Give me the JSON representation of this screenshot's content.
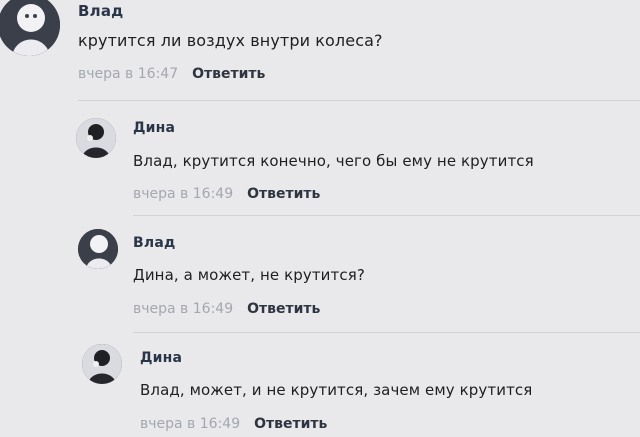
{
  "comments": [
    {
      "author": "Влад",
      "text": "крутится ли воздух внутри колеса?",
      "time": "вчера в 16:47",
      "reply": "Ответить",
      "avatar": "avatar-white-figure"
    },
    {
      "author": "Дина",
      "text": "Влад, крутится конечно, чего бы ему не крутится",
      "time": "вчера в 16:49",
      "reply": "Ответить",
      "avatar": "avatar-dark-figure"
    },
    {
      "author": "Влад",
      "text": "Дина, а может, не крутится?",
      "time": "вчера в 16:49",
      "reply": "Ответить",
      "avatar": "avatar-white-figure"
    },
    {
      "author": "Дина",
      "text": "Влад, может, и не крутится, зачем ему крутится",
      "time": "вчера в 16:49",
      "reply": "Ответить",
      "avatar": "avatar-dark-figure"
    }
  ]
}
